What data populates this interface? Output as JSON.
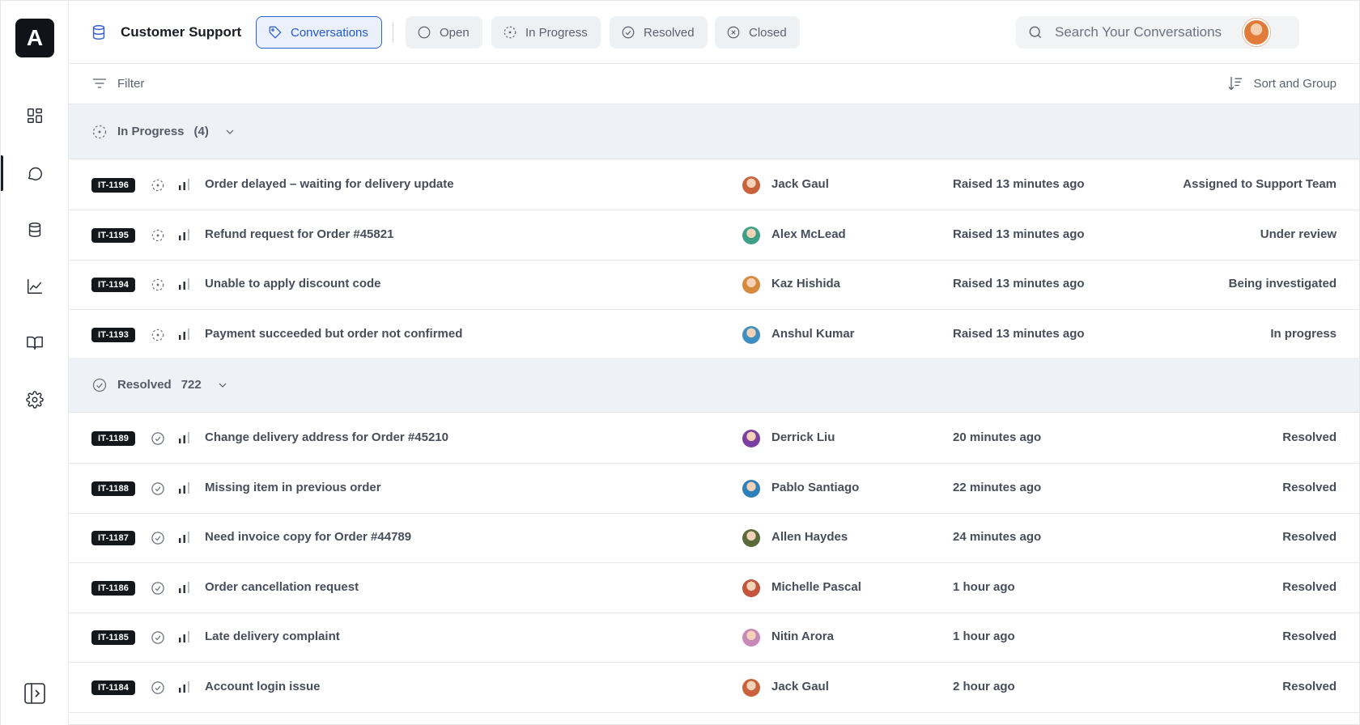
{
  "app": {
    "logo_letter": "A"
  },
  "header": {
    "title": "Customer Support",
    "tabs": [
      {
        "label": "Conversations",
        "icon": "tag-icon",
        "active": true
      },
      {
        "label": "Open",
        "icon": "circle-icon",
        "active": false
      },
      {
        "label": "In Progress",
        "icon": "dashed-circle-icon",
        "active": false
      },
      {
        "label": "Resolved",
        "icon": "check-circle-icon",
        "active": false
      },
      {
        "label": "Closed",
        "icon": "x-circle-icon",
        "active": false
      }
    ],
    "search_placeholder": "Search Your Conversations"
  },
  "toolbar": {
    "filter_label": "Filter",
    "sort_label": "Sort and Group"
  },
  "sidebar": {
    "items": [
      {
        "icon": "dashboard-icon"
      },
      {
        "icon": "chat-icon",
        "active": true
      },
      {
        "icon": "database-icon"
      },
      {
        "icon": "analytics-icon"
      },
      {
        "icon": "book-icon"
      },
      {
        "icon": "settings-icon"
      }
    ]
  },
  "groups": {
    "in_progress": {
      "label": "In Progress",
      "count": "(4)"
    },
    "resolved": {
      "label": "Resolved",
      "count": "722"
    }
  },
  "in_progress_rows": [
    {
      "id": "IT-1196",
      "title": "Order delayed – waiting for delivery update",
      "assignee": "Jack Gaul",
      "time": "Raised 13 minutes ago",
      "status": "Assigned to Support Team",
      "avatar_color": "#c9623c"
    },
    {
      "id": "IT-1195",
      "title": "Refund request for Order #45821",
      "assignee": "Alex McLead",
      "time": "Raised 13 minutes ago",
      "status": "Under review",
      "avatar_color": "#3fa08a"
    },
    {
      "id": "IT-1194",
      "title": "Unable to apply discount code",
      "assignee": "Kaz Hishida",
      "time": "Raised 13 minutes ago",
      "status": "Being investigated",
      "avatar_color": "#d58a3c"
    },
    {
      "id": "IT-1193",
      "title": "Payment succeeded but order not confirmed",
      "assignee": "Anshul Kumar",
      "time": "Raised 13 minutes ago",
      "status": "In progress",
      "avatar_color": "#3f8fc0"
    }
  ],
  "resolved_rows": [
    {
      "id": "IT-1189",
      "title": "Change delivery address for Order #45210",
      "assignee": "Derrick Liu",
      "time": "20 minutes ago",
      "status": "Resolved",
      "avatar_color": "#7b3fa0"
    },
    {
      "id": "IT-1188",
      "title": "Missing item in previous order",
      "assignee": "Pablo Santiago",
      "time": "22 minutes ago",
      "status": "Resolved",
      "avatar_color": "#2f7fb8"
    },
    {
      "id": "IT-1187",
      "title": "Need invoice copy for Order #44789",
      "assignee": "Allen Haydes",
      "time": "24 minutes ago",
      "status": "Resolved",
      "avatar_color": "#5a6a3a"
    },
    {
      "id": "IT-1186",
      "title": "Order cancellation request",
      "assignee": "Michelle Pascal",
      "time": "1 hour ago",
      "status": "Resolved",
      "avatar_color": "#c2553a"
    },
    {
      "id": "IT-1185",
      "title": "Late delivery complaint",
      "assignee": "Nitin Arora",
      "time": "1 hour ago",
      "status": "Resolved",
      "avatar_color": "#c78ab8"
    },
    {
      "id": "IT-1184",
      "title": "Account login issue",
      "assignee": "Jack Gaul",
      "time": "2 hour ago",
      "status": "Resolved",
      "avatar_color": "#c9623c"
    }
  ],
  "colors": {
    "accent": "#2f62d8",
    "group_bg": "#eef2f6",
    "tag_bg": "#14171c"
  }
}
